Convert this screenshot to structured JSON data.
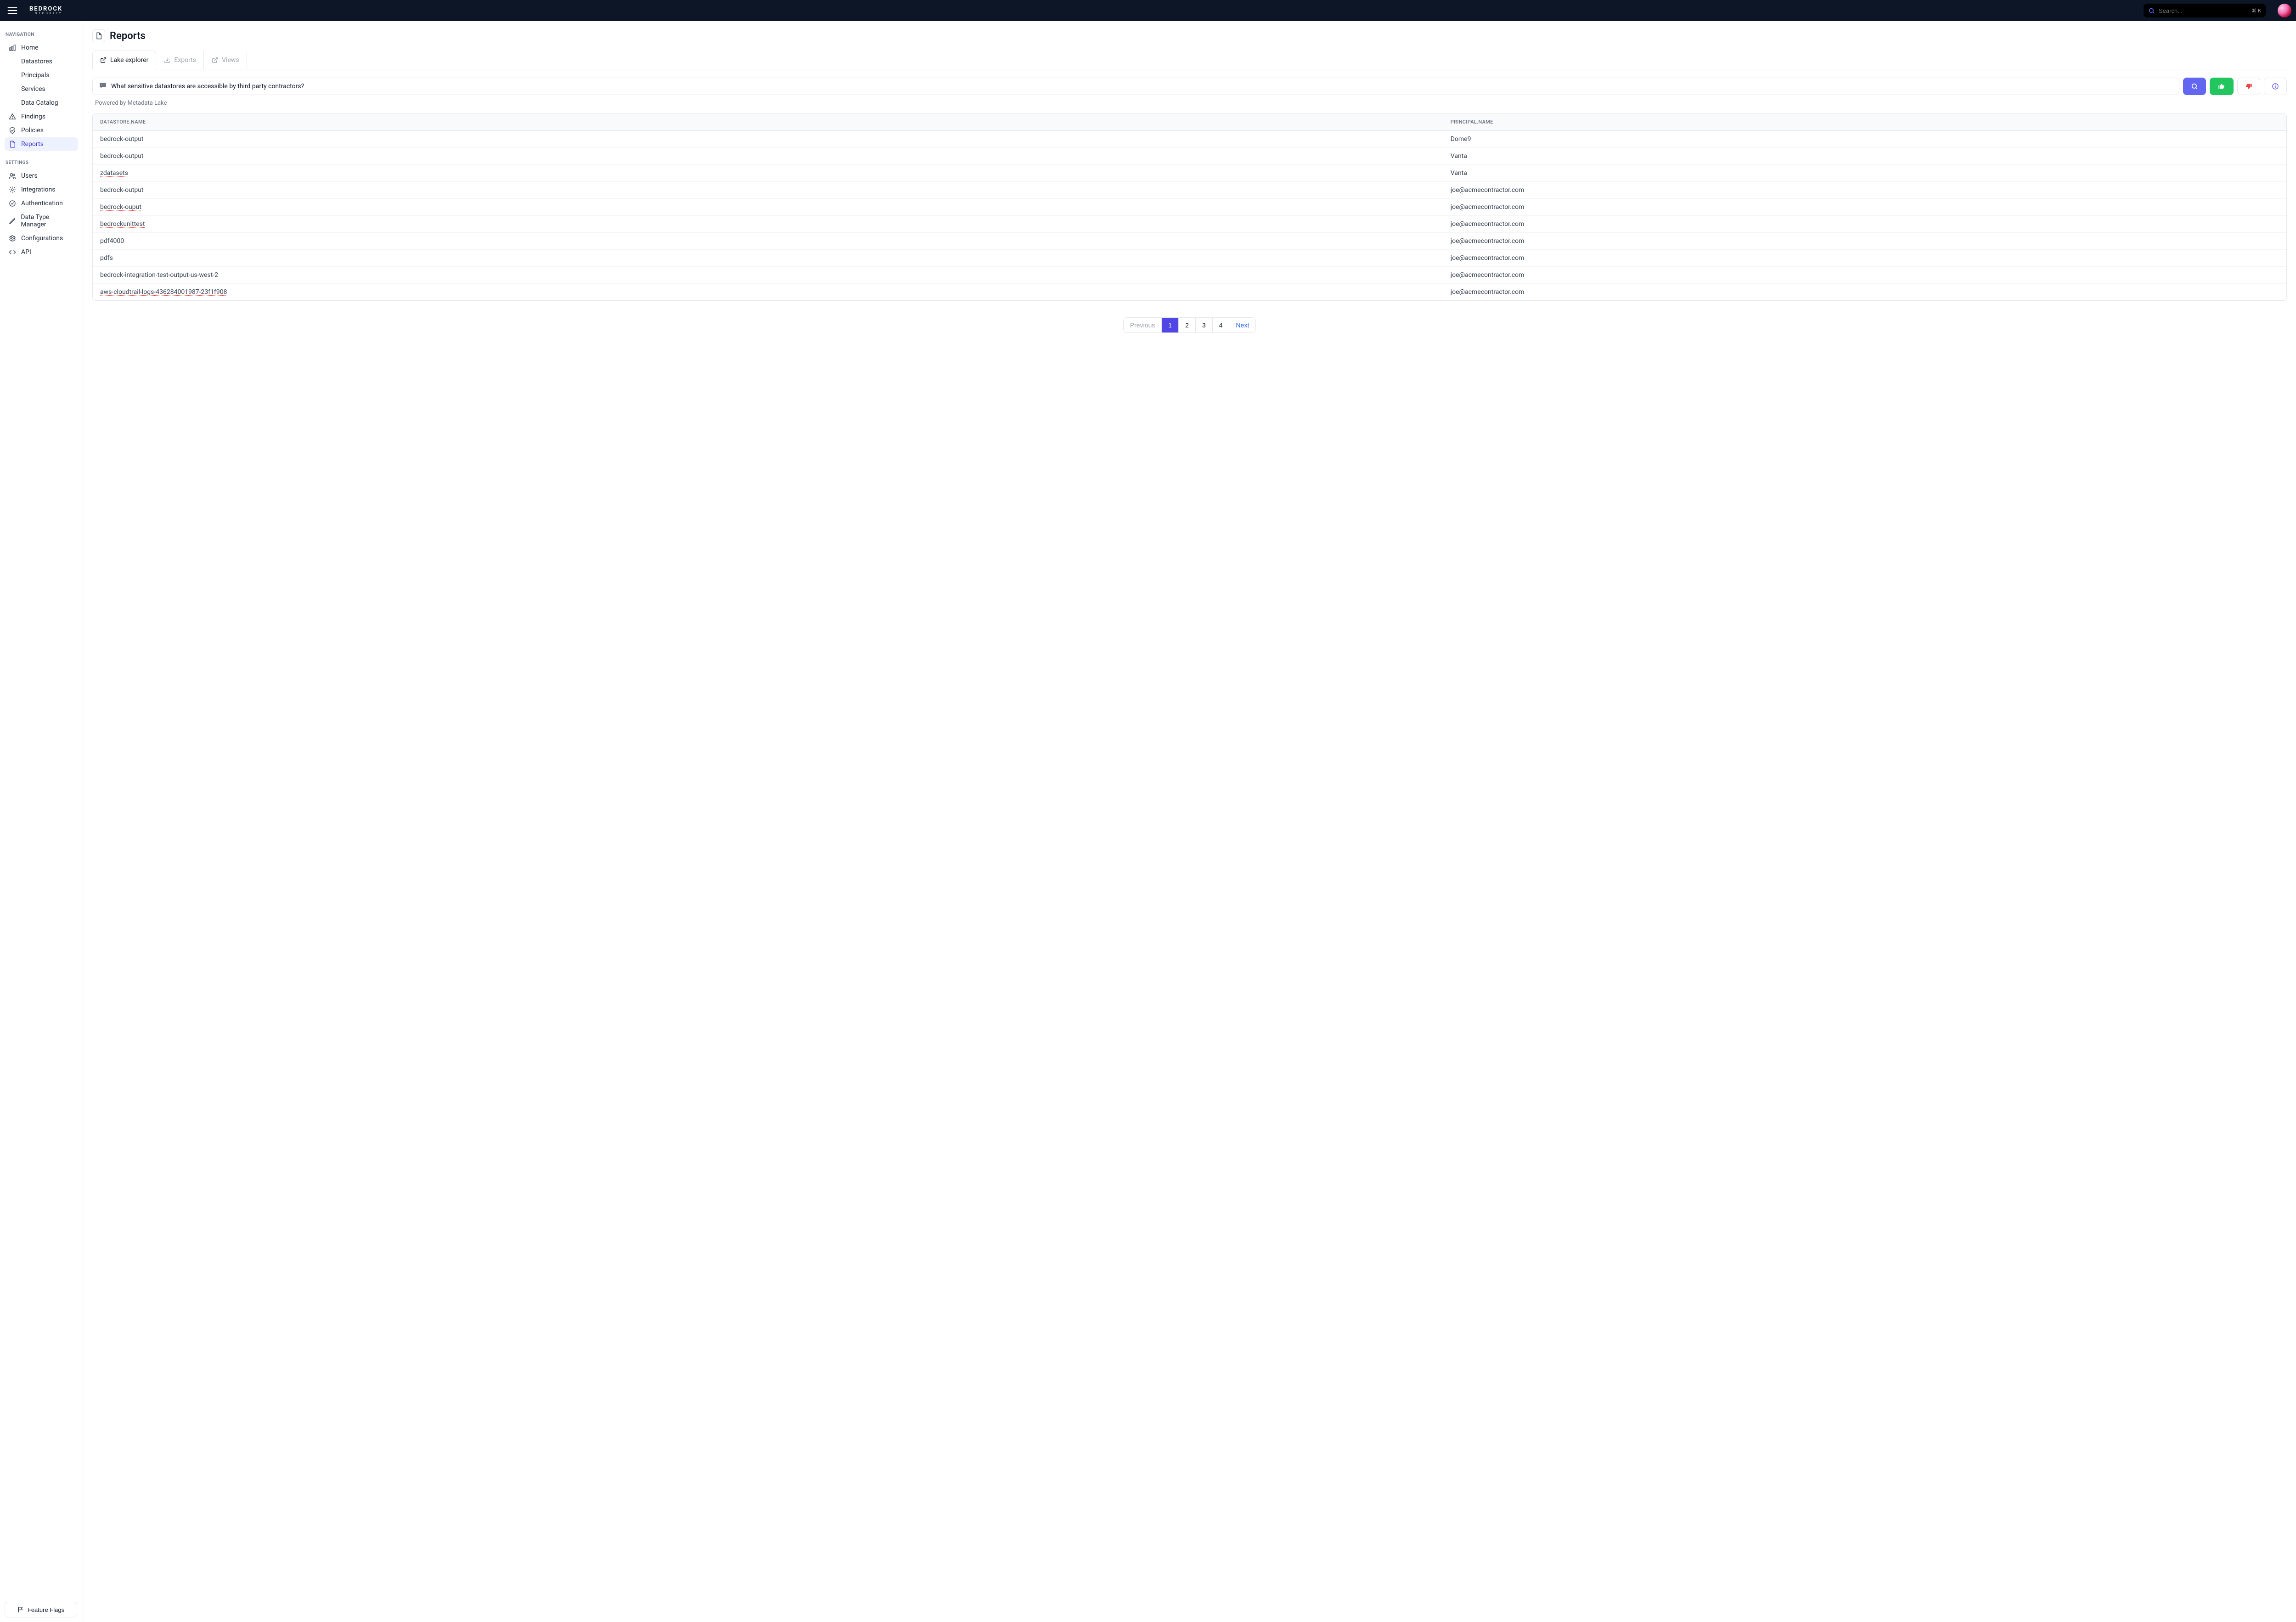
{
  "header": {
    "logo_main": "BEDROCK",
    "logo_sub": "SECURITY",
    "search_placeholder": "Search...",
    "search_shortcut": "⌘ K"
  },
  "sidebar": {
    "section_nav": "NAVIGATION",
    "section_settings": "SETTINGS",
    "items_nav": [
      {
        "label": "Home"
      },
      {
        "label": "Datastores"
      },
      {
        "label": "Principals"
      },
      {
        "label": "Services"
      },
      {
        "label": "Data Catalog"
      },
      {
        "label": "Findings"
      },
      {
        "label": "Policies"
      },
      {
        "label": "Reports"
      }
    ],
    "items_settings": [
      {
        "label": "Users"
      },
      {
        "label": "Integrations"
      },
      {
        "label": "Authentication"
      },
      {
        "label": "Data Type Manager"
      },
      {
        "label": "Configurations"
      },
      {
        "label": "API"
      }
    ],
    "feature_flags": "Feature Flags"
  },
  "page": {
    "title": "Reports",
    "tabs": [
      {
        "label": "Lake explorer"
      },
      {
        "label": "Exports"
      },
      {
        "label": "Views"
      }
    ],
    "query": "What sensitive datastores are accessible  by third party contractors?",
    "powered": "Powered by Metadata Lake"
  },
  "table": {
    "columns": [
      "DATASTORE.NAME",
      "PRINCIPAL.NAME"
    ],
    "rows": [
      {
        "datastore": "bedrock-output",
        "principal": "Dome9",
        "dotted": false
      },
      {
        "datastore": "bedrock-output",
        "principal": "Vanta",
        "dotted": false
      },
      {
        "datastore": "zdatasets",
        "principal": "Vanta",
        "dotted": true
      },
      {
        "datastore": "bedrock-output",
        "principal": "joe@acmecontractor.com",
        "dotted": false
      },
      {
        "datastore": "bedrock-ouput",
        "principal": "joe@acmecontractor.com",
        "dotted": true
      },
      {
        "datastore": "bedrockunittest",
        "principal": "joe@acmecontractor.com",
        "dotted": true
      },
      {
        "datastore": "pdf4000",
        "principal": "joe@acmecontractor.com",
        "dotted": false
      },
      {
        "datastore": "pdfs",
        "principal": "joe@acmecontractor.com",
        "dotted": false
      },
      {
        "datastore": "bedrock-integration-test-output-us-west-2",
        "principal": "joe@acmecontractor.com",
        "dotted": false
      },
      {
        "datastore": "aws-cloudtrail-logs-436284001987-23f1f908",
        "principal": "joe@acmecontractor.com",
        "dotted": true
      }
    ]
  },
  "pagination": {
    "previous": "Previous",
    "next": "Next",
    "pages": [
      "1",
      "2",
      "3",
      "4"
    ],
    "active": "1"
  }
}
